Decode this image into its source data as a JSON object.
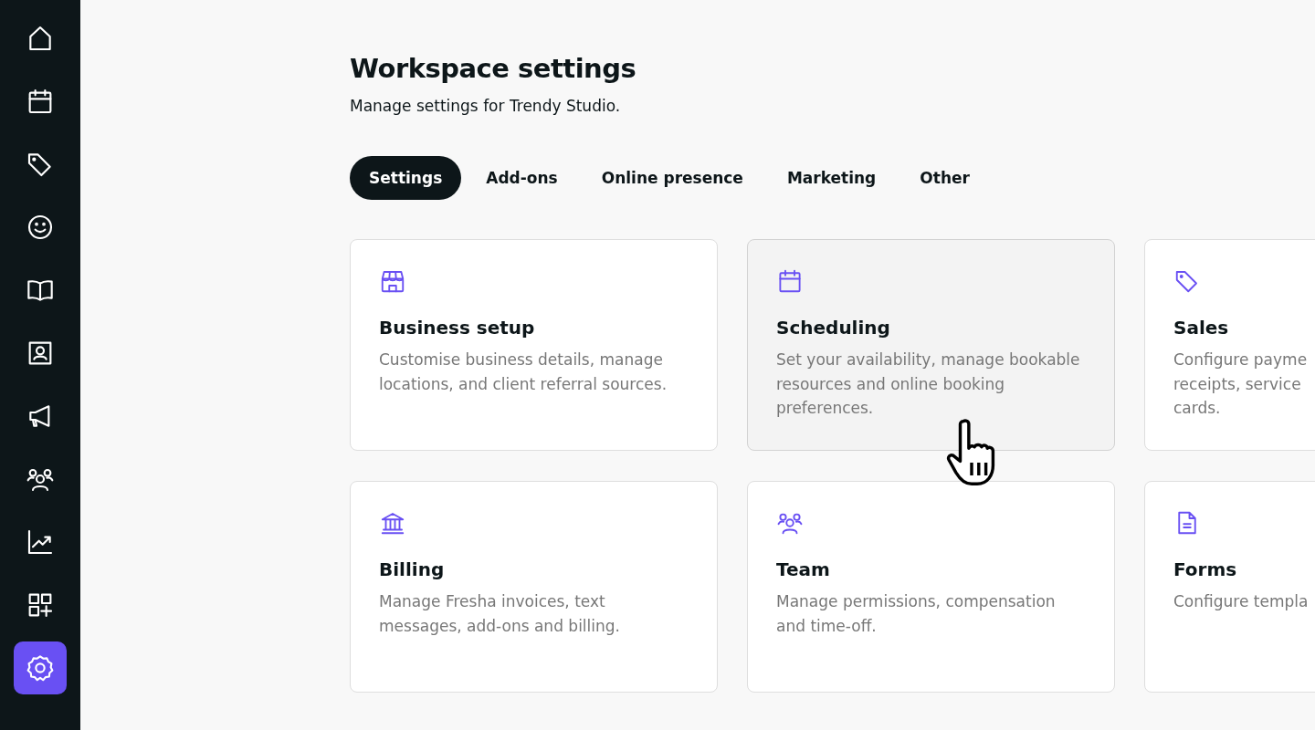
{
  "sidebar": {
    "items": [
      {
        "selected": false
      },
      {
        "selected": false
      },
      {
        "selected": false
      },
      {
        "selected": false
      },
      {
        "selected": false
      },
      {
        "selected": false
      },
      {
        "selected": false
      },
      {
        "selected": false
      },
      {
        "selected": false
      },
      {
        "selected": false
      },
      {
        "selected": true
      }
    ]
  },
  "title": "Workspace settings",
  "subtitle": "Manage settings for Trendy Studio.",
  "tabs": [
    {
      "label": "Settings",
      "selected": true
    },
    {
      "label": "Add-ons",
      "selected": false
    },
    {
      "label": "Online presence",
      "selected": false
    },
    {
      "label": "Marketing",
      "selected": false
    },
    {
      "label": "Other",
      "selected": false
    }
  ],
  "cards": [
    {
      "title": "Business setup",
      "lines": [
        "Customise business details, manage",
        "locations, and client referral sources."
      ],
      "hovered": false
    },
    {
      "title": "Scheduling",
      "lines": [
        "Set your availability, manage bookable",
        "resources and online booking",
        "preferences."
      ],
      "hovered": true
    },
    {
      "title": "Sales",
      "lines": [
        "Configure payme",
        "receipts, service",
        "cards."
      ],
      "hovered": false
    },
    {
      "title": "Billing",
      "lines": [
        "Manage Fresha invoices, text",
        "messages, add-ons and billing."
      ],
      "hovered": false
    },
    {
      "title": "Team",
      "lines": [
        "Manage permissions, compensation",
        "and time-off."
      ],
      "hovered": false
    },
    {
      "title": "Forms",
      "lines": [
        "Configure templa"
      ],
      "hovered": false
    }
  ]
}
